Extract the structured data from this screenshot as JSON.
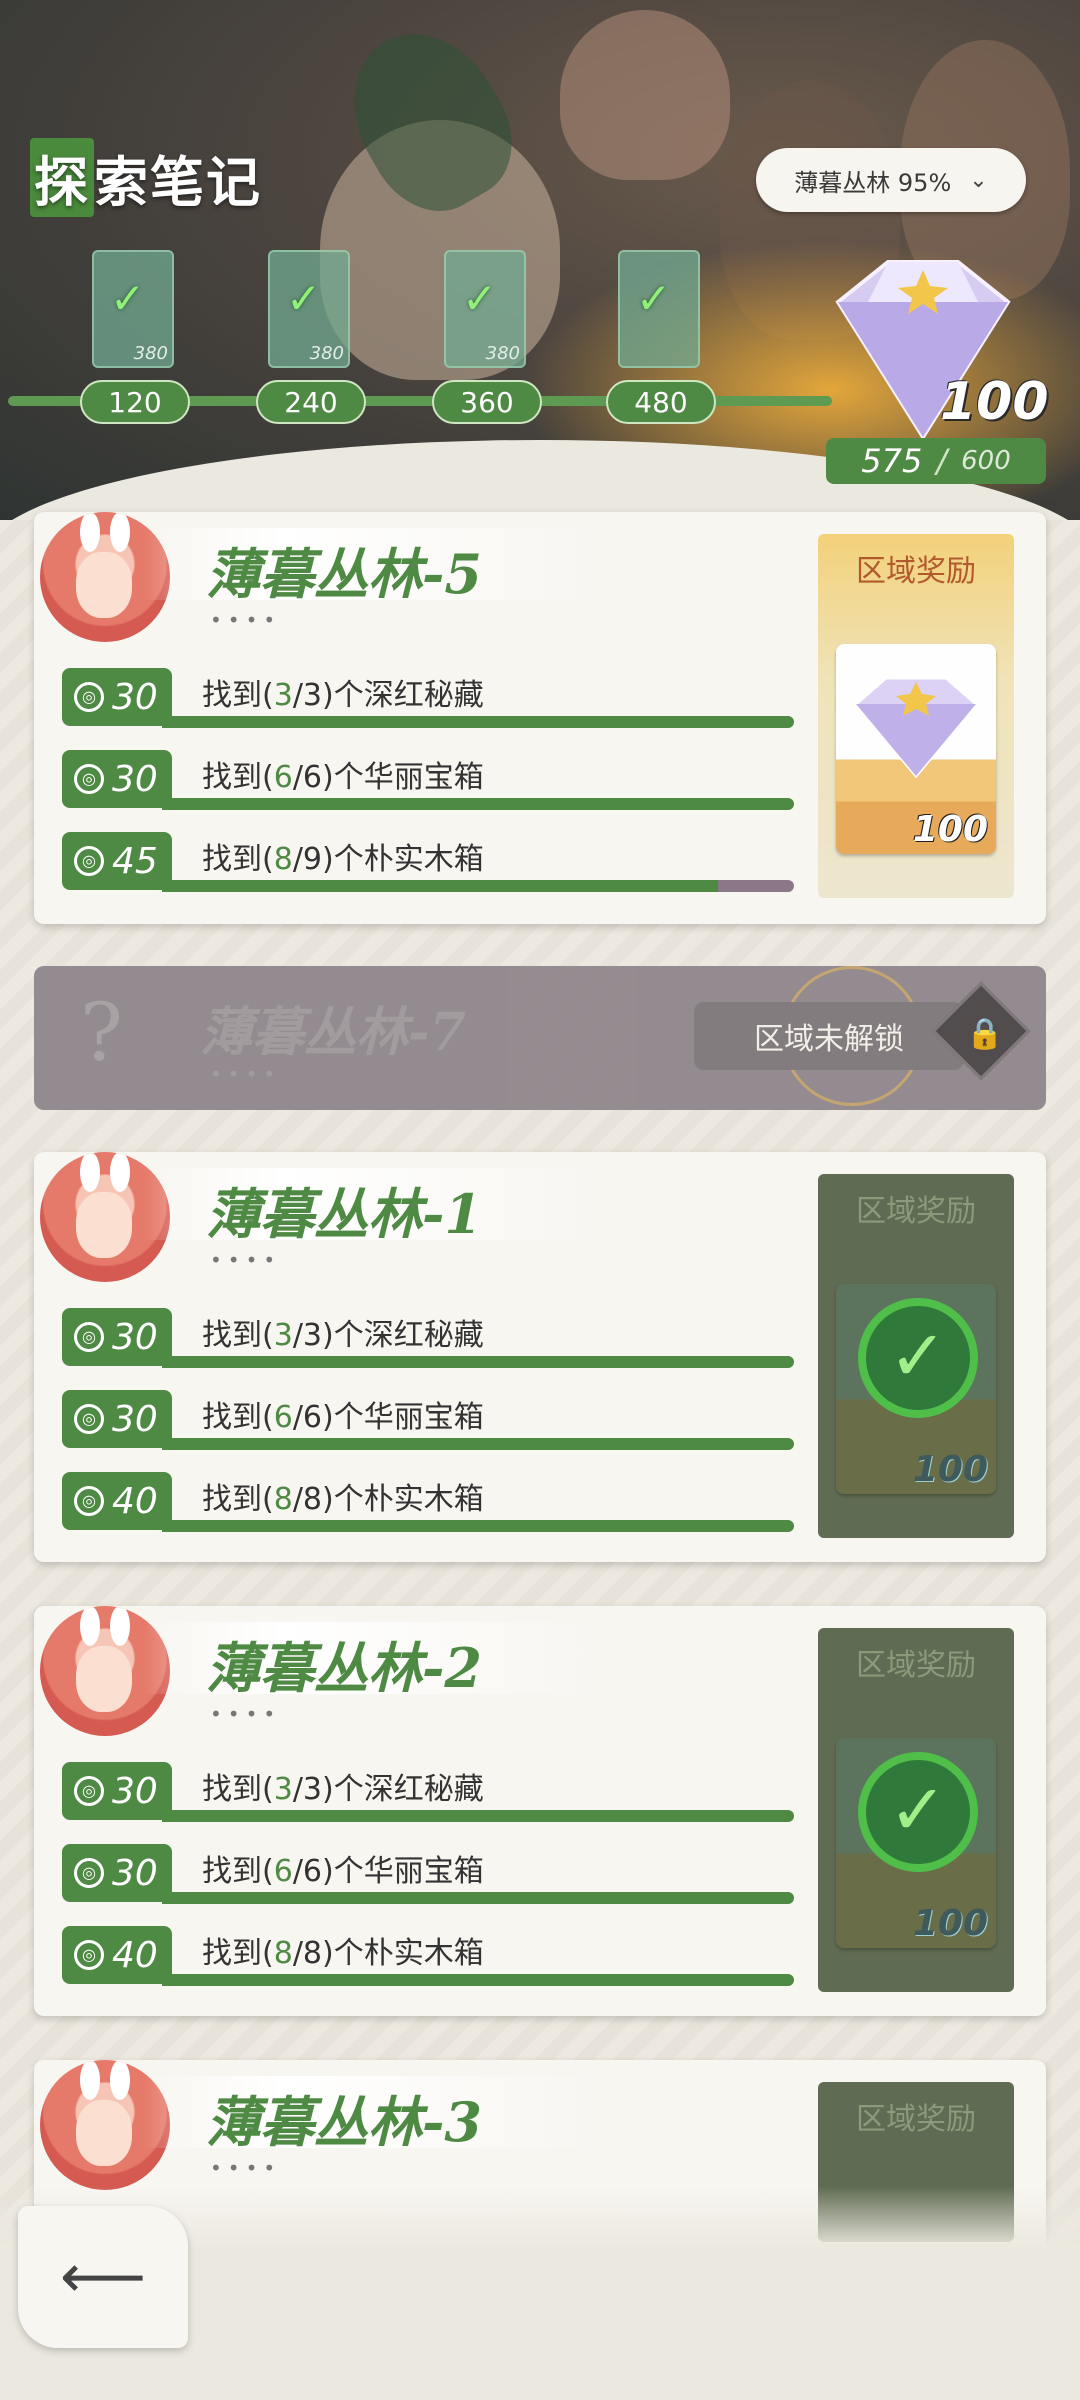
{
  "header": {
    "title_first": "探",
    "title_rest": "索笔记",
    "region_label": "薄暮丛林 95%",
    "milestones": [
      {
        "card_value": "380",
        "threshold": "120"
      },
      {
        "card_value": "380",
        "threshold": "240"
      },
      {
        "card_value": "380",
        "threshold": "360"
      },
      {
        "card_value": "",
        "threshold": "480"
      }
    ],
    "gem_count": "100",
    "progress_current": "575",
    "progress_sep": "/",
    "progress_max": "600"
  },
  "cards": [
    {
      "title": "薄暮丛林-5",
      "dots": "••••",
      "reward_label": "区域奖励",
      "reward_value": "100",
      "claimed": false,
      "tasks": [
        {
          "time": "30",
          "pre": "找到(",
          "done": "3",
          "total": "/3)",
          "post": "个深红秘藏"
        },
        {
          "time": "30",
          "pre": "找到(",
          "done": "6",
          "total": "/6)",
          "post": "个华丽宝箱"
        },
        {
          "time": "45",
          "pre": "找到(",
          "done": "8",
          "total": "/9)",
          "post": "个朴实木箱"
        }
      ]
    },
    {
      "title": "薄暮丛林-1",
      "dots": "••••",
      "reward_label": "区域奖励",
      "reward_value": "100",
      "claimed": true,
      "tasks": [
        {
          "time": "30",
          "pre": "找到(",
          "done": "3",
          "total": "/3)",
          "post": "个深红秘藏"
        },
        {
          "time": "30",
          "pre": "找到(",
          "done": "6",
          "total": "/6)",
          "post": "个华丽宝箱"
        },
        {
          "time": "40",
          "pre": "找到(",
          "done": "8",
          "total": "/8)",
          "post": "个朴实木箱"
        }
      ]
    },
    {
      "title": "薄暮丛林-2",
      "dots": "••••",
      "reward_label": "区域奖励",
      "reward_value": "100",
      "claimed": true,
      "tasks": [
        {
          "time": "30",
          "pre": "找到(",
          "done": "3",
          "total": "/3)",
          "post": "个深红秘藏"
        },
        {
          "time": "30",
          "pre": "找到(",
          "done": "6",
          "total": "/6)",
          "post": "个华丽宝箱"
        },
        {
          "time": "40",
          "pre": "找到(",
          "done": "8",
          "total": "/8)",
          "post": "个朴实木箱"
        }
      ]
    },
    {
      "title": "薄暮丛林-3",
      "dots": "••••",
      "reward_label": "区域奖励"
    }
  ],
  "locked": {
    "qmark": "?",
    "title": "薄暮丛林-7",
    "dots": "••••",
    "label": "区域未解锁"
  },
  "icons": {
    "back": "back-arrow-icon",
    "lock": "lock-icon",
    "timer": "compass-timer-icon",
    "check": "check-icon"
  },
  "colors": {
    "accent": "#4e8a44",
    "reward_label": "#b25a2c"
  }
}
